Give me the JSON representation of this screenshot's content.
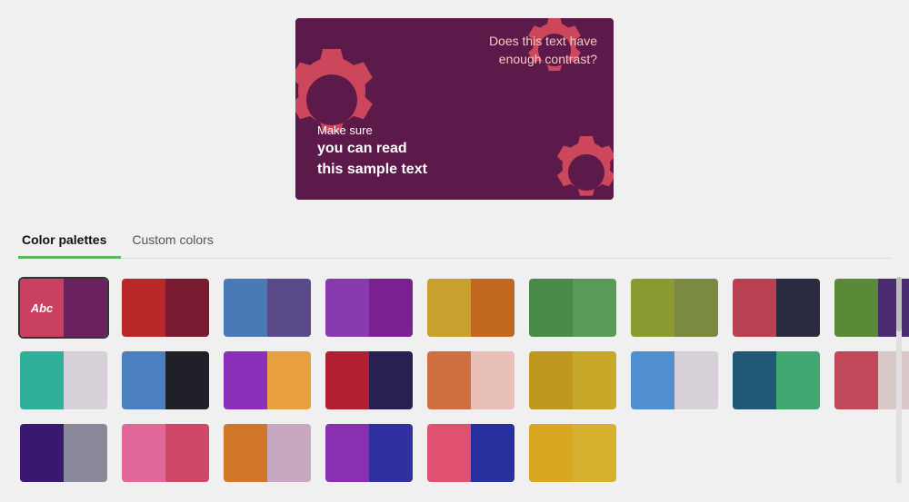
{
  "preview": {
    "text_top": "Does this text have\nenough contrast?",
    "text_bottom_line1": "Make sure",
    "text_bottom_line2": "you can read\nthis sample text"
  },
  "tabs": [
    {
      "label": "Color palettes",
      "active": true
    },
    {
      "label": "Custom colors",
      "active": false
    }
  ],
  "palettes": [
    [
      {
        "left": "#c94060",
        "right": "#6b2060",
        "label": "Abc",
        "selected": true
      },
      {
        "left": "#b82828",
        "right": "#7a1a30",
        "dotted_left": true
      },
      {
        "left": "#4a7ab5",
        "right": "#5a4a8a"
      },
      {
        "left": "#8a3ab0",
        "right": "#7a2090"
      },
      {
        "left": "#c8a030",
        "right": "#c06820"
      },
      {
        "left": "#4a8a48",
        "right": "#5a9a58"
      },
      {
        "left": "#8a9a30",
        "right": "#7a8a40"
      },
      {
        "left": "#b84050",
        "right": "#2a2a40"
      },
      {
        "left": "#5a8a38",
        "right": "#4a2a70"
      }
    ],
    [
      {
        "left": "#30b09a",
        "right": "#d8d0d8"
      },
      {
        "left": "#4a80c0",
        "right": "#202028"
      },
      {
        "left": "#8a30b8",
        "right": "#e8a040"
      },
      {
        "left": "#b02030",
        "right": "#282050"
      },
      {
        "left": "#d07040",
        "right": "#e8c0b8",
        "dotted_right": true
      },
      {
        "left": "#c09820",
        "right": "#d8a820",
        "dotted_left": true
      },
      {
        "left": "#5090d0",
        "right": "#d8d0d8"
      },
      {
        "left": "#205878",
        "right": "#40a870"
      },
      {
        "left": "#c04858",
        "right": "#d8c8c8"
      }
    ],
    [
      {
        "left": "#3a1870",
        "right": "#888898"
      },
      {
        "left": "#e06898",
        "right": "#d04868",
        "dotted_left": true
      },
      {
        "left": "#d07828",
        "right": "#c8a8c0"
      },
      {
        "left": "#8830b0",
        "right": "#3030a0"
      },
      {
        "left": "#e05070",
        "right": "#2830a0"
      },
      {
        "left": "#d8a820",
        "right": "#d8b030",
        "dotted_left": true
      }
    ]
  ]
}
